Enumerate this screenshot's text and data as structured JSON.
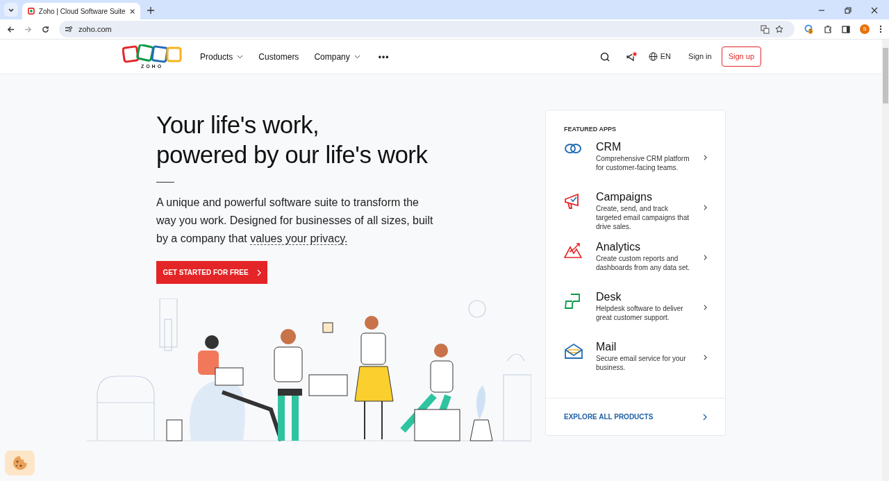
{
  "browser": {
    "tab_title": "Zoho | Cloud Software Suite",
    "url": "zoho.com",
    "extension_badge": "3",
    "profile_initial": "S"
  },
  "nav": {
    "logo_text": "ZOHO",
    "items": [
      {
        "label": "Products",
        "dropdown": true
      },
      {
        "label": "Customers",
        "dropdown": false
      },
      {
        "label": "Company",
        "dropdown": true
      }
    ],
    "more": "•••",
    "language": "EN",
    "sign_in": "Sign in",
    "sign_up": "Sign up"
  },
  "hero": {
    "title_lines": [
      "Your life's work,",
      "powered by our life's work"
    ],
    "description": "A unique and powerful software suite to transform the way you work. Designed for businesses of all sizes, built by a company that ",
    "description_link": "values your privacy.",
    "cta": "GET STARTED FOR FREE"
  },
  "featured": {
    "heading": "FEATURED APPS",
    "apps": [
      {
        "name": "CRM",
        "description": "Comprehensive CRM platform for customer-facing teams."
      },
      {
        "name": "Campaigns",
        "description": "Create, send, and track targeted email campaigns that drive sales."
      },
      {
        "name": "Analytics",
        "description": "Create custom reports and dashboards from any data set."
      },
      {
        "name": "Desk",
        "description": "Helpdesk software to deliver great customer support."
      },
      {
        "name": "Mail",
        "description": "Secure email service for your business."
      }
    ],
    "explore": "EXPLORE ALL PRODUCTS"
  }
}
